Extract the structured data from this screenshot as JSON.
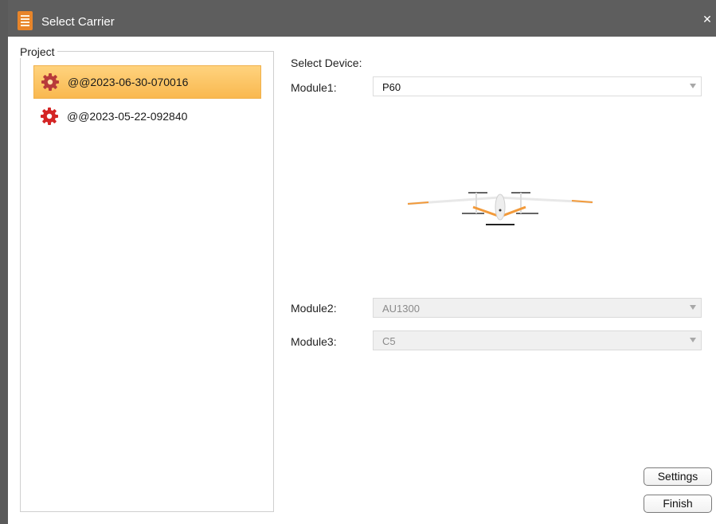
{
  "window": {
    "title": "Select Carrier",
    "close_symbol": "✕"
  },
  "project": {
    "legend": "Project",
    "items": [
      {
        "label": "@@2023-06-30-070016",
        "selected": true,
        "icon": "gear-icon"
      },
      {
        "label": "@@2023-05-22-092840",
        "selected": false,
        "icon": "gear-icon"
      }
    ]
  },
  "device": {
    "heading": "Select Device:",
    "module1": {
      "label": "Module1:",
      "value": "P60",
      "enabled": true
    },
    "module2": {
      "label": "Module2:",
      "value": "AU1300",
      "enabled": false
    },
    "module3": {
      "label": "Module3:",
      "value": "C5",
      "enabled": false
    },
    "preview_icon": "vtol-drone-image"
  },
  "buttons": {
    "settings": "Settings",
    "finish": "Finish"
  },
  "colors": {
    "titlebar": "#5e5e5e",
    "selected_item": "#fcc463",
    "gear_icon": "#cc2a2a",
    "app_icon": "#e8852a"
  }
}
